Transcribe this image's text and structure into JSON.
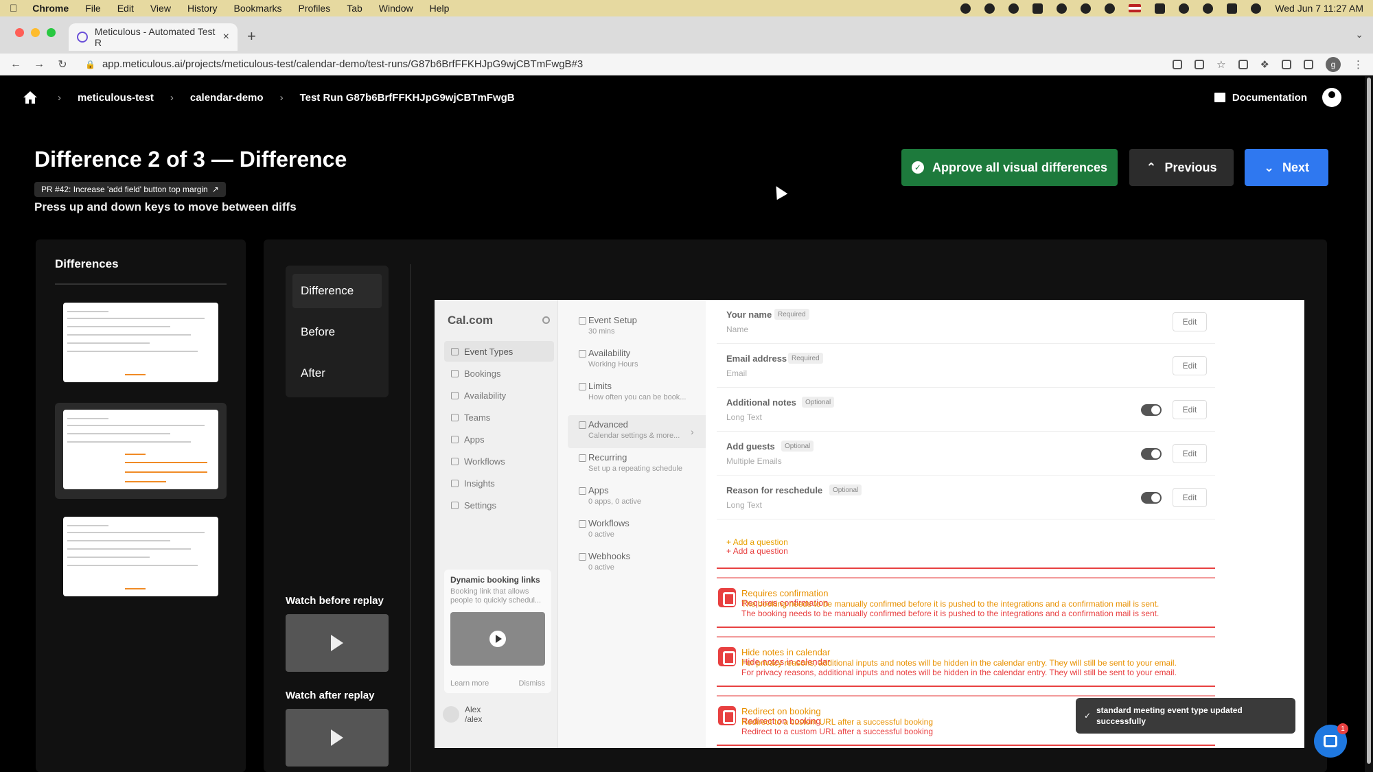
{
  "menubar": {
    "app": "Chrome",
    "items": [
      "File",
      "Edit",
      "View",
      "History",
      "Bookmarks",
      "Profiles",
      "Tab",
      "Window",
      "Help"
    ],
    "clock": "Wed Jun 7  11:27 AM"
  },
  "browser": {
    "tab_title": "Meticulous - Automated Test R",
    "url": "app.meticulous.ai/projects/meticulous-test/calendar-demo/test-runs/G87b6BrfFFKHJpG9wjCBTmFwgB#3",
    "profile_initial": "g"
  },
  "header": {
    "breadcrumbs": [
      "meticulous-test",
      "calendar-demo",
      "Test Run G87b6BrfFFKHJpG9wjCBTmFwgB"
    ],
    "documentation": "Documentation"
  },
  "title": "Difference 2 of 3 — Difference",
  "pr_badge": "PR #42: Increase 'add field' button top margin",
  "hint": "Press up and down keys to move between diffs",
  "buttons": {
    "approve": "Approve all visual differences",
    "previous": "Previous",
    "next": "Next"
  },
  "differences": {
    "title": "Differences"
  },
  "view_tabs": [
    "Difference",
    "Before",
    "After"
  ],
  "replays": {
    "before": "Watch before replay",
    "after": "Watch after replay"
  },
  "screenshot": {
    "logo": "Cal.com",
    "side_items": [
      "Event Types",
      "Bookings",
      "Availability",
      "Teams",
      "Apps",
      "Workflows",
      "Insights",
      "Settings"
    ],
    "promo": {
      "title": "Dynamic booking links",
      "text": "Booking link that allows people to quickly schedul...",
      "learn": "Learn more",
      "dismiss": "Dismiss"
    },
    "user": {
      "name": "Alex",
      "handle": "/alex"
    },
    "settings": [
      {
        "title": "Event Setup",
        "sub": "30 mins"
      },
      {
        "title": "Availability",
        "sub": "Working Hours"
      },
      {
        "title": "Limits",
        "sub": "How often you can be book..."
      },
      {
        "title": "Advanced",
        "sub": "Calendar settings & more..."
      },
      {
        "title": "Recurring",
        "sub": "Set up a repeating schedule"
      },
      {
        "title": "Apps",
        "sub": "0 apps, 0 active"
      },
      {
        "title": "Workflows",
        "sub": "0 active"
      },
      {
        "title": "Webhooks",
        "sub": "0 active"
      }
    ],
    "questions": [
      {
        "label": "Your name",
        "tag": "Required",
        "type": "Name",
        "edit": "Edit"
      },
      {
        "label": "Email address",
        "tag": "Required",
        "type": "Email",
        "edit": "Edit"
      },
      {
        "label": "Additional notes",
        "tag": "Optional",
        "type": "Long Text",
        "edit": "Edit"
      },
      {
        "label": "Add guests",
        "tag": "Optional",
        "type": "Multiple Emails",
        "edit": "Edit"
      },
      {
        "label": "Reason for reschedule",
        "tag": "Optional",
        "type": "Long Text",
        "edit": "Edit"
      }
    ],
    "add_question": "Add a question",
    "diffs": [
      {
        "title": "Requires confirmation",
        "desc": "The booking needs to be manually confirmed before it is pushed to the integrations and a confirmation mail is sent."
      },
      {
        "title": "Hide notes in calendar",
        "desc": "For privacy reasons, additional inputs and notes will be hidden in the calendar entry. They will still be sent to your email."
      },
      {
        "title": "Redirect on booking",
        "desc": "Redirect to a custom URL after a successful booking"
      }
    ],
    "toast": "standard meeting event type updated successfully"
  },
  "chat_badge": "1",
  "colors": {
    "approve": "#1d7a3c",
    "next": "#2f78f0",
    "diff": "#e84040"
  }
}
